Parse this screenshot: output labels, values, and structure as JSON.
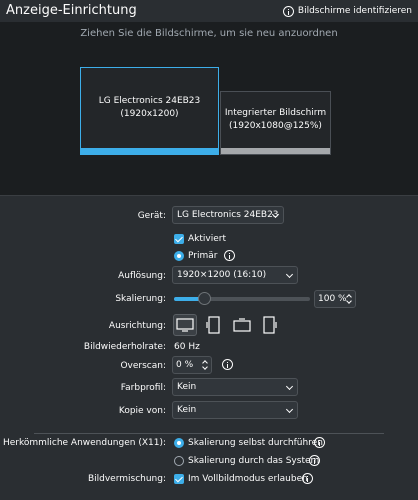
{
  "window": {
    "title": "Anzeige-Einrichtung",
    "identify_label": "Bildschirme identifizieren"
  },
  "canvas": {
    "hint": "Ziehen Sie die Bildschirme, um sie neu anzuordnen",
    "monitors": [
      {
        "name": "LG Electronics 24EB23",
        "mode": "(1920x1200)",
        "selected": true
      },
      {
        "name": "Integrierter Bildschirm",
        "mode": "(1920x1080@125%)",
        "selected": false
      }
    ]
  },
  "form": {
    "device_label": "Gerät:",
    "device_value": "LG Electronics 24EB23",
    "enabled_label": "Aktiviert",
    "primary_label": "Primär",
    "resolution_label": "Auflösung:",
    "resolution_value": "1920×1200 (16:10)",
    "scale_label": "Skalierung:",
    "scale_value": "100 %",
    "scale_fraction": 0.22,
    "orientation_label": "Ausrichtung:",
    "refresh_label": "Bildwiederholrate:",
    "refresh_value": "60 Hz",
    "overscan_label": "Overscan:",
    "overscan_value": "0 %",
    "color_profile_label": "Farbprofil:",
    "color_profile_value": "Kein",
    "copy_from_label": "Kopie von:",
    "copy_from_value": "Kein",
    "legacy_label": "Herkömmliche Anwendungen (X11):",
    "legacy_opt1": "Skalierung selbst durchführen",
    "legacy_opt2": "Skalierung durch das System",
    "blend_label": "Bildvermischung:",
    "blend_value": "Im Vollbildmodus erlauben"
  },
  "colors": {
    "accent": "#3daee9",
    "background": "#2a2e32",
    "canvas": "#1b1e20"
  }
}
